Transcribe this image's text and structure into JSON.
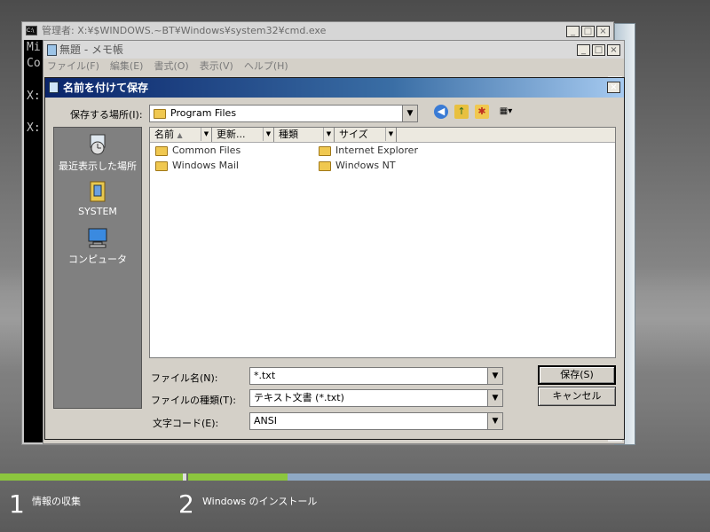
{
  "cmd": {
    "title": "管理者: X:¥$WINDOWS.~BT¥Windows¥system32¥cmd.exe",
    "lines": [
      "Mi",
      "Co",
      "X:",
      "X:"
    ]
  },
  "notepad": {
    "title": "無題 - メモ帳",
    "menu": [
      "ファイル(F)",
      "編集(E)",
      "書式(O)",
      "表示(V)",
      "ヘルプ(H)"
    ]
  },
  "dialog": {
    "title": "名前を付けて保存",
    "location_label": "保存する場所(I):",
    "location_value": "Program Files",
    "places": [
      "最近表示した場所",
      "SYSTEM",
      "コンピュータ"
    ],
    "columns": [
      "名前",
      "更新...",
      "種類",
      "サイズ"
    ],
    "files": [
      {
        "name": "Common Files"
      },
      {
        "name": "Windows Mail"
      },
      {
        "name": "Internet Explorer"
      },
      {
        "name": "Windows NT"
      }
    ],
    "filename_label": "ファイル名(N):",
    "filename_value": "*.txt",
    "filetype_label": "ファイルの種類(T):",
    "filetype_value": "テキスト文書 (*.txt)",
    "encoding_label": "文字コード(E):",
    "encoding_value": "ANSI",
    "save_label": "保存(S)",
    "cancel_label": "キャンセル"
  },
  "setup": {
    "step1_num": "1",
    "step1_label": "情報の収集",
    "step2_num": "2",
    "step2_label": "Windows のインストール"
  },
  "colors": {
    "progress_done": "#8cc63e",
    "progress_pending": "#8fa9c4",
    "title_active": "#0a246a"
  },
  "icons": [
    "cmd-icon",
    "notepad-icon",
    "back-icon",
    "up-folder-icon",
    "new-folder-icon",
    "view-menu-icon",
    "folder-icon",
    "recent-places-icon",
    "system-icon",
    "computer-icon",
    "close-icon",
    "minimize-icon",
    "maximize-icon"
  ]
}
